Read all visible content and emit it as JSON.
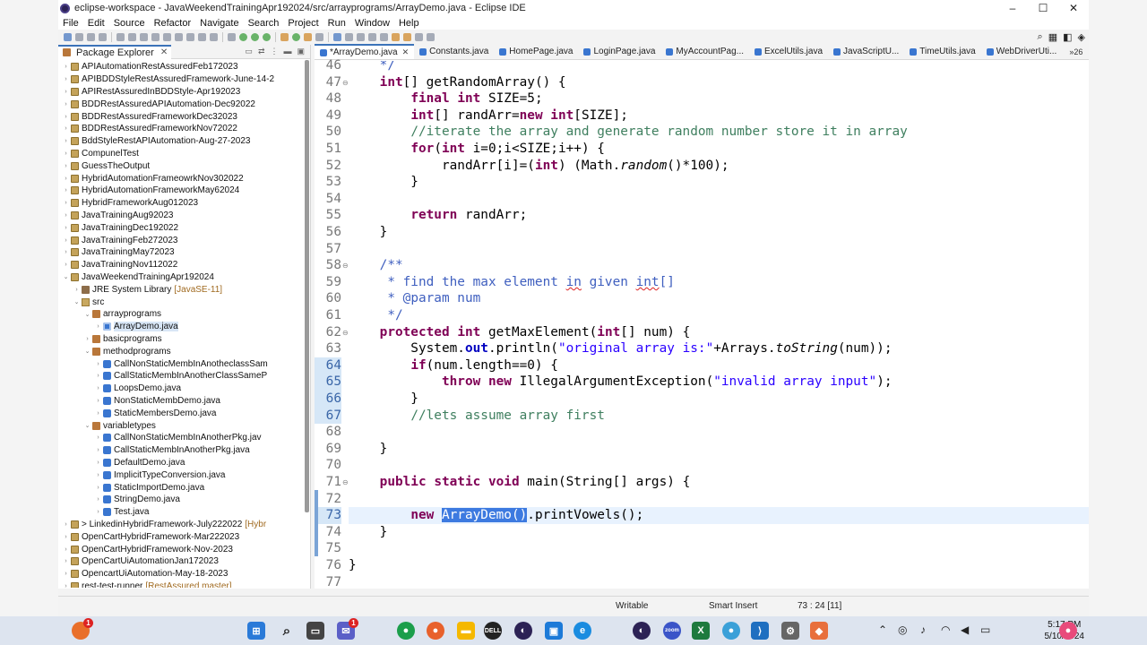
{
  "window": {
    "title": "eclipse-workspace - JavaWeekendTrainingApr192024/src/arrayprograms/ArrayDemo.java - Eclipse IDE",
    "minimize": "–",
    "maximize": "☐",
    "close": "✕"
  },
  "menu": [
    "File",
    "Edit",
    "Source",
    "Refactor",
    "Navigate",
    "Search",
    "Project",
    "Run",
    "Window",
    "Help"
  ],
  "explorer": {
    "title": "Package Explorer",
    "close": "✕",
    "items": [
      {
        "label": "APIAutomationRestAssuredFeb172023",
        "indent": 0,
        "arrow": "›",
        "icon": "proj"
      },
      {
        "label": "APIBDDStyleRestAssuredFramework-June-14-2",
        "indent": 0,
        "arrow": "›",
        "icon": "proj"
      },
      {
        "label": "APIRestAssuredInBDDStyle-Apr192023",
        "indent": 0,
        "arrow": "›",
        "icon": "proj"
      },
      {
        "label": "BDDRestAssuredAPIAutomation-Dec92022",
        "indent": 0,
        "arrow": "›",
        "icon": "proj"
      },
      {
        "label": "BDDRestAssuredFrameworkDec32023",
        "indent": 0,
        "arrow": "›",
        "icon": "proj"
      },
      {
        "label": "BDDRestAssuredFrameworkNov72022",
        "indent": 0,
        "arrow": "›",
        "icon": "proj"
      },
      {
        "label": "BddStyleRestAPIAutomation-Aug-27-2023",
        "indent": 0,
        "arrow": "›",
        "icon": "proj"
      },
      {
        "label": "CompunelTest",
        "indent": 0,
        "arrow": "›",
        "icon": "proj"
      },
      {
        "label": "GuessTheOutput",
        "indent": 0,
        "arrow": "›",
        "icon": "proj"
      },
      {
        "label": "HybridAutomationFrameowrkNov302022",
        "indent": 0,
        "arrow": "›",
        "icon": "proj"
      },
      {
        "label": "HybridAutomationFrameworkMay62024",
        "indent": 0,
        "arrow": "›",
        "icon": "proj"
      },
      {
        "label": "HybridFrameworkAug012023",
        "indent": 0,
        "arrow": "›",
        "icon": "proj"
      },
      {
        "label": "JavaTrainingAug92023",
        "indent": 0,
        "arrow": "›",
        "icon": "proj"
      },
      {
        "label": "JavaTrainingDec192022",
        "indent": 0,
        "arrow": "›",
        "icon": "proj"
      },
      {
        "label": "JavaTrainingFeb272023",
        "indent": 0,
        "arrow": "›",
        "icon": "proj"
      },
      {
        "label": "JavaTrainingMay72023",
        "indent": 0,
        "arrow": "›",
        "icon": "proj"
      },
      {
        "label": "JavaTrainingNov112022",
        "indent": 0,
        "arrow": "›",
        "icon": "proj"
      },
      {
        "label": "JavaWeekendTrainingApr192024",
        "indent": 0,
        "arrow": "⌄",
        "icon": "proj"
      },
      {
        "label": "JRE System Library",
        "extra": "[JavaSE-11]",
        "indent": 1,
        "arrow": "›",
        "icon": "lib"
      },
      {
        "label": "src",
        "indent": 1,
        "arrow": "⌄",
        "icon": "src"
      },
      {
        "label": "arrayprograms",
        "indent": 2,
        "arrow": "⌄",
        "icon": "pkg"
      },
      {
        "label": "ArrayDemo.java",
        "indent": 3,
        "arrow": "›",
        "icon": "java mod",
        "selected": true
      },
      {
        "label": "basicprograms",
        "indent": 2,
        "arrow": "›",
        "icon": "pkg"
      },
      {
        "label": "methodprograms",
        "indent": 2,
        "arrow": "⌄",
        "icon": "pkg"
      },
      {
        "label": "CallNonStaticMembInAnotheclassSam",
        "indent": 3,
        "arrow": "›",
        "icon": "java"
      },
      {
        "label": "CallStaticMembInAnotherClassSameP",
        "indent": 3,
        "arrow": "›",
        "icon": "java"
      },
      {
        "label": "LoopsDemo.java",
        "indent": 3,
        "arrow": "›",
        "icon": "java"
      },
      {
        "label": "NonStaticMembDemo.java",
        "indent": 3,
        "arrow": "›",
        "icon": "java"
      },
      {
        "label": "StaticMembersDemo.java",
        "indent": 3,
        "arrow": "›",
        "icon": "java"
      },
      {
        "label": "variabletypes",
        "indent": 2,
        "arrow": "⌄",
        "icon": "pkg"
      },
      {
        "label": "CallNonStaticMembInAnotherPkg.jav",
        "indent": 3,
        "arrow": "›",
        "icon": "java"
      },
      {
        "label": "CallStaticMembInAnotherPkg.java",
        "indent": 3,
        "arrow": "›",
        "icon": "java"
      },
      {
        "label": "DefaultDemo.java",
        "indent": 3,
        "arrow": "›",
        "icon": "java"
      },
      {
        "label": "ImplicitTypeConversion.java",
        "indent": 3,
        "arrow": "›",
        "icon": "java"
      },
      {
        "label": "StaticImportDemo.java",
        "indent": 3,
        "arrow": "›",
        "icon": "java"
      },
      {
        "label": "StringDemo.java",
        "indent": 3,
        "arrow": "›",
        "icon": "java"
      },
      {
        "label": "Test.java",
        "indent": 3,
        "arrow": "›",
        "icon": "java"
      },
      {
        "label": "> LinkedinHybridFramework-July222022",
        "extra": "[Hybr",
        "indent": 0,
        "arrow": "›",
        "icon": "proj"
      },
      {
        "label": "OpenCartHybridFramework-Mar222023",
        "indent": 0,
        "arrow": "›",
        "icon": "proj"
      },
      {
        "label": "OpenCartHybridFramework-Nov-2023",
        "indent": 0,
        "arrow": "›",
        "icon": "proj"
      },
      {
        "label": "OpenCartUiAutomationJan172023",
        "indent": 0,
        "arrow": "›",
        "icon": "proj"
      },
      {
        "label": "OpencartUiAutomation-May-18-2023",
        "indent": 0,
        "arrow": "›",
        "icon": "proj"
      },
      {
        "label": "rest-test-runner",
        "extra": "[RestAssured master]",
        "indent": 0,
        "arrow": "›",
        "icon": "proj"
      }
    ]
  },
  "editor_tabs": {
    "tabs": [
      "*ArrayDemo.java",
      "Constants.java",
      "HomePage.java",
      "LoginPage.java",
      "MyAccountPag...",
      "ExcelUtils.java",
      "JavaScriptU...",
      "TimeUtils.java",
      "WebDriverUti..."
    ],
    "active_index": 0,
    "close": "✕",
    "overflow": "»26"
  },
  "code": {
    "first_line_number": 46,
    "current_line": 73,
    "lines": [
      [
        {
          "t": "    */",
          "c": "jd"
        }
      ],
      [
        {
          "t": "    "
        },
        {
          "t": "int",
          "c": "kw"
        },
        {
          "t": "[] getRandomArray() {"
        }
      ],
      [
        {
          "t": "        "
        },
        {
          "t": "final",
          "c": "kw"
        },
        {
          "t": " "
        },
        {
          "t": "int",
          "c": "kw"
        },
        {
          "t": " SIZE=5;"
        }
      ],
      [
        {
          "t": "        "
        },
        {
          "t": "int",
          "c": "kw"
        },
        {
          "t": "[] randArr="
        },
        {
          "t": "new",
          "c": "kw"
        },
        {
          "t": " "
        },
        {
          "t": "int",
          "c": "kw"
        },
        {
          "t": "[SIZE];"
        }
      ],
      [
        {
          "t": "        "
        },
        {
          "t": "//iterate the array and generate random number store it in array",
          "c": "cm"
        }
      ],
      [
        {
          "t": "        "
        },
        {
          "t": "for",
          "c": "kw"
        },
        {
          "t": "("
        },
        {
          "t": "int",
          "c": "kw"
        },
        {
          "t": " i=0;i<SIZE;i++) {"
        }
      ],
      [
        {
          "t": "            randArr[i]=("
        },
        {
          "t": "int",
          "c": "kw"
        },
        {
          "t": ") (Math."
        },
        {
          "t": "random",
          "c": "it"
        },
        {
          "t": "()*100);"
        }
      ],
      [
        {
          "t": "        }"
        }
      ],
      [
        {
          "t": ""
        }
      ],
      [
        {
          "t": "        "
        },
        {
          "t": "return",
          "c": "kw"
        },
        {
          "t": " randArr;"
        }
      ],
      [
        {
          "t": "    }"
        }
      ],
      [
        {
          "t": ""
        }
      ],
      [
        {
          "t": "    "
        },
        {
          "t": "/**",
          "c": "jd"
        }
      ],
      [
        {
          "t": "     * find the max element ",
          "c": "jd"
        },
        {
          "t": "in",
          "c": "jd ul"
        },
        {
          "t": " given ",
          "c": "jd"
        },
        {
          "t": "int",
          "c": "jd ul"
        },
        {
          "t": "[]",
          "c": "jd"
        }
      ],
      [
        {
          "t": "     * ",
          "c": "jd"
        },
        {
          "t": "@param",
          "c": "jd"
        },
        {
          "t": " num",
          "c": "jd"
        }
      ],
      [
        {
          "t": "     */",
          "c": "jd"
        }
      ],
      [
        {
          "t": "    "
        },
        {
          "t": "protected",
          "c": "kw"
        },
        {
          "t": " "
        },
        {
          "t": "int",
          "c": "kw"
        },
        {
          "t": " getMaxElement("
        },
        {
          "t": "int",
          "c": "kw"
        },
        {
          "t": "[] num) {"
        }
      ],
      [
        {
          "t": "        System."
        },
        {
          "t": "out",
          "c": "fld"
        },
        {
          "t": ".println("
        },
        {
          "t": "\"original array is:\"",
          "c": "str"
        },
        {
          "t": "+Arrays."
        },
        {
          "t": "toString",
          "c": "it"
        },
        {
          "t": "(num));"
        }
      ],
      [
        {
          "t": "        "
        },
        {
          "t": "if",
          "c": "kw"
        },
        {
          "t": "(num.length==0) {"
        }
      ],
      [
        {
          "t": "            "
        },
        {
          "t": "throw",
          "c": "kw"
        },
        {
          "t": " "
        },
        {
          "t": "new",
          "c": "kw"
        },
        {
          "t": " IllegalArgumentException("
        },
        {
          "t": "\"invalid array input\"",
          "c": "str"
        },
        {
          "t": ");"
        }
      ],
      [
        {
          "t": "        }"
        }
      ],
      [
        {
          "t": "        "
        },
        {
          "t": "//lets assume array first",
          "c": "cm"
        }
      ],
      [
        {
          "t": ""
        }
      ],
      [
        {
          "t": "    }"
        }
      ],
      [
        {
          "t": ""
        }
      ],
      [
        {
          "t": "    "
        },
        {
          "t": "public",
          "c": "kw"
        },
        {
          "t": " "
        },
        {
          "t": "static",
          "c": "kw"
        },
        {
          "t": " "
        },
        {
          "t": "void",
          "c": "kw"
        },
        {
          "t": " main(String[] args) {"
        }
      ],
      [
        {
          "t": ""
        }
      ],
      [
        {
          "t": "        "
        },
        {
          "t": "new",
          "c": "kw"
        },
        {
          "t": " "
        },
        {
          "t": "ArrayDemo()",
          "c": "selc"
        },
        {
          "t": ".printVowels();"
        }
      ],
      [
        {
          "t": "    }"
        }
      ],
      [
        {
          "t": ""
        }
      ],
      [
        {
          "t": "}"
        }
      ],
      [
        {
          "t": ""
        }
      ]
    ]
  },
  "status": {
    "writable": "Writable",
    "insert_mode": "Smart Insert",
    "position": "73 : 24 [11]"
  },
  "taskbar": {
    "badge_count": "1",
    "chat_badge": "1",
    "time": "5:17 PM",
    "date": "5/10/2024"
  }
}
